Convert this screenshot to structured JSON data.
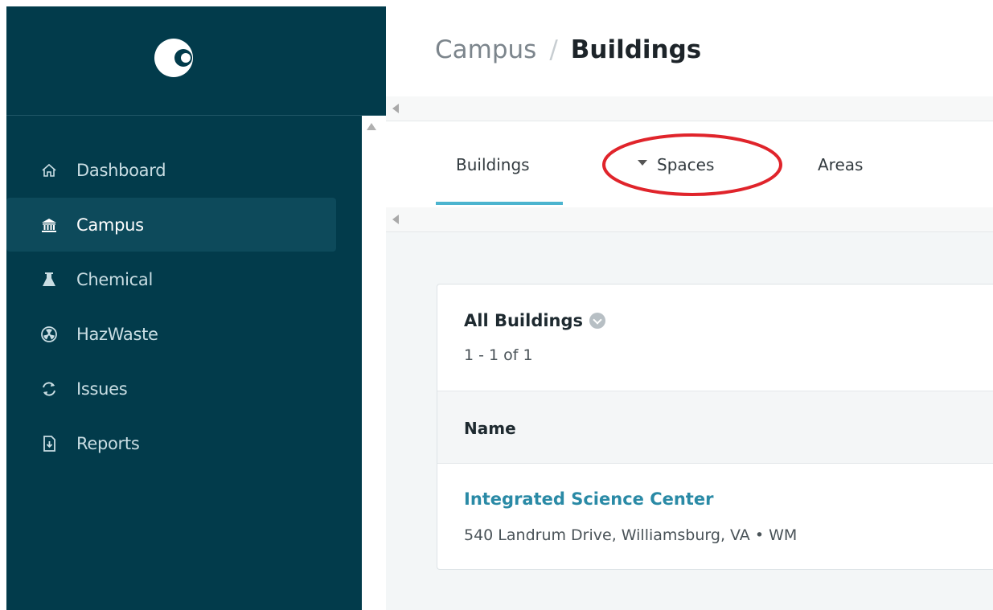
{
  "breadcrumb": {
    "parent": "Campus",
    "separator": "/",
    "current": "Buildings"
  },
  "sidebar": {
    "items": [
      {
        "label": "Dashboard",
        "icon": "home-icon"
      },
      {
        "label": "Campus",
        "icon": "bank-icon",
        "active": true
      },
      {
        "label": "Chemical",
        "icon": "flask-icon"
      },
      {
        "label": "HazWaste",
        "icon": "radiation-icon"
      },
      {
        "label": "Issues",
        "icon": "refresh-icon"
      },
      {
        "label": "Reports",
        "icon": "report-file-icon"
      }
    ]
  },
  "tabs": [
    {
      "label": "Buildings",
      "active": true
    },
    {
      "label": "Spaces",
      "dropdown": true
    },
    {
      "label": "Areas"
    }
  ],
  "list": {
    "title": "All Buildings",
    "count": "1 - 1 of 1",
    "column_header": "Name",
    "rows": [
      {
        "name": "Integrated Science Center",
        "address": "540 Landrum Drive, Williamsburg, VA • WM"
      }
    ]
  },
  "colors": {
    "sidebar_bg": "#023b4b",
    "active_tab_indicator": "#4cb4cf",
    "link": "#2a8aa6",
    "annotation": "#e0242b"
  }
}
